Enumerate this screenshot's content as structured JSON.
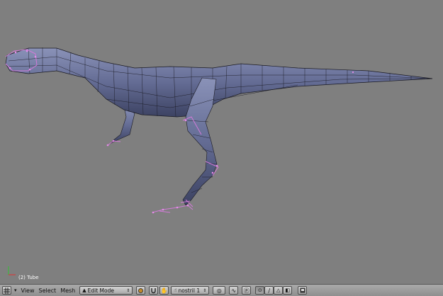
{
  "viewport": {
    "object_label": "(2) Tube",
    "background_color": "#7f7f7f",
    "mesh_fill_color": "#646c94",
    "wire_color": "#1a1a22",
    "selected_vertex_color": "#d27ad8"
  },
  "header": {
    "editor_type_icon": "grid-icon",
    "menus": [
      "View",
      "Select",
      "Mesh"
    ],
    "mode": {
      "label": "Edit Mode",
      "options_visible": "Edit Mode"
    },
    "pivot_icon": "pivot-icon",
    "magnet_icon": "magnet-icon",
    "hand_icon": "hand-icon",
    "layer_field": "nostril 1",
    "proportional_icon": "proportional-icon",
    "snap_icon": "snap-icon",
    "select_vertex_icon": "vertex-select-icon",
    "select_edge_icon": "edge-select-icon",
    "select_face_icon": "face-select-icon",
    "occlude_icon": "occlude-icon",
    "render_icon": "render-icon"
  }
}
